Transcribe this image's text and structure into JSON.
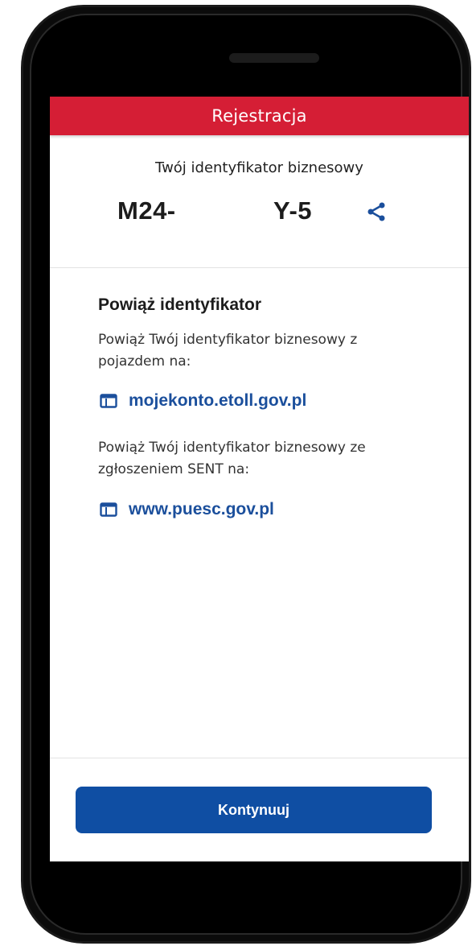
{
  "header": {
    "title": "Rejestracja",
    "color": "#d51e35"
  },
  "identifier": {
    "caption": "Twój identyfikator biznesowy",
    "value_prefix": "M24-",
    "value_suffix": "Y-5",
    "share_icon": "share-icon"
  },
  "link_section": {
    "title": "Powiąż identyfikator",
    "text_1": "Powiąż Twój identyfikator biznesowy z pojazdem na:",
    "link_1": "mojekonto.etoll.gov.pl",
    "text_2": "Powiąż Twój identyfikator biznesowy ze zgłoszeniem SENT na:",
    "link_2": "www.puesc.gov.pl",
    "link_icon": "browser-window-icon",
    "link_color": "#1b4f9c"
  },
  "footer": {
    "continue_label": "Kontynuuj",
    "button_color": "#0f4ea3"
  }
}
